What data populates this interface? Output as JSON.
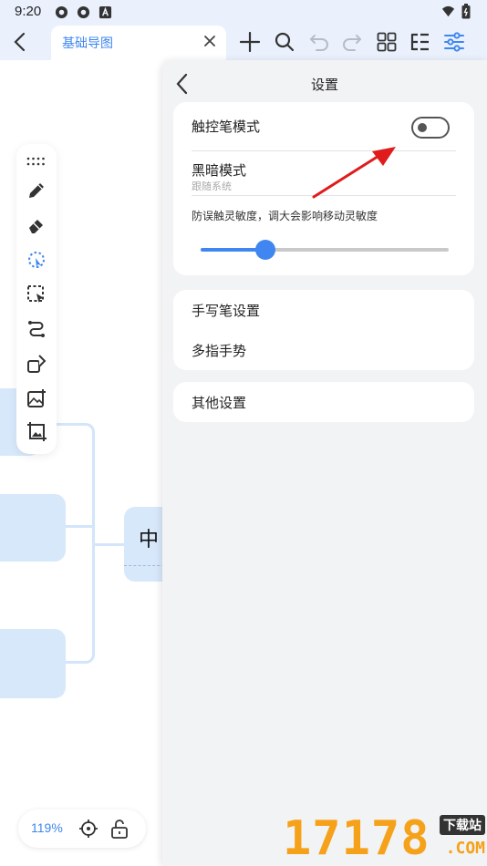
{
  "status_bar": {
    "time": "9:20",
    "icons": [
      "gear-icon",
      "gear-icon",
      "a-badge-icon"
    ],
    "right_icons": [
      "wifi-icon",
      "battery-icon"
    ]
  },
  "toolbar": {
    "back_icon": "chevron-left-icon",
    "tab_title": "基础导图",
    "tab_close_icon": "close-icon",
    "actions": [
      "plus-icon",
      "search-icon",
      "undo-icon",
      "redo-icon",
      "grid-icon",
      "outline-icon",
      "sliders-icon"
    ]
  },
  "canvas": {
    "center_node_text": "中",
    "left_tools": [
      "more-dots-icon",
      "pen-icon",
      "eraser-icon",
      "lasso-icon",
      "select-icon",
      "path-icon",
      "shapes-icon",
      "image-add-icon",
      "image-crop-icon"
    ],
    "zoom_level": "119%",
    "zoom_icons": [
      "locate-icon",
      "unlock-icon"
    ]
  },
  "settings": {
    "title": "设置",
    "stylus_mode_label": "触控笔模式",
    "stylus_mode_on": false,
    "dark_mode_label": "黑暗模式",
    "dark_mode_value": "跟随系统",
    "sensitivity_label": "防误触灵敏度，调大会影响移动灵敏度",
    "sensitivity_value": 0.26,
    "handwriting_label": "手写笔设置",
    "multi_touch_label": "多指手势",
    "other_label": "其他设置"
  },
  "colors": {
    "accent": "#3f86f0",
    "node": "#d8e8fb",
    "annotation_arrow": "#e01b1b"
  },
  "watermark": {
    "text": "17178",
    "sub": "下载站",
    "domain": ".COM"
  }
}
